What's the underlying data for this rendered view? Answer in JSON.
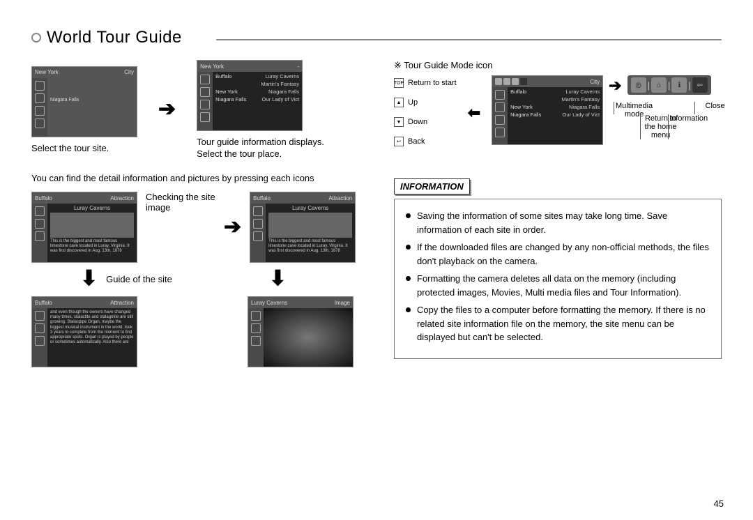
{
  "header": {
    "title": "World Tour Guide"
  },
  "left": {
    "shot1": {
      "top_left": "New York",
      "top_right": "City",
      "caption": "Select the tour site.",
      "place_label": "Niagara Falls"
    },
    "shot2": {
      "top_left": "New York",
      "top_right": "-",
      "caption1": "Tour guide information displays.",
      "caption2": "Select the tour place.",
      "list": [
        "Buffalo",
        "Luray Caverns",
        "Martin's Fantasy",
        "New York",
        "Niagara Falls",
        "Our Lady of Vict"
      ]
    },
    "para": "You can find the detail information and pictures by pressing each icons",
    "checking": "Checking the site image",
    "shot3": {
      "top_left": "Buffalo",
      "top_right": "Attraction",
      "subtitle": "Luray Caverns",
      "desc": "This is the biggest and most famous limestone cave located in Luray, Virginia. It was first discovered in Aug. 13th, 1878"
    },
    "shot4": {
      "top_left": "Buffalo",
      "top_right": "Attraction",
      "subtitle": "Luray Caverns",
      "desc": "This is the biggest and most famous limestone cave located in Luray, Virginia. It was first discovered in Aug. 13th, 1878"
    },
    "guide": "Guide of the site",
    "shot5": {
      "top_left": "Buffalo",
      "top_right": "Attraction",
      "desc": "and even though the owners have changed many times, stalactite and stalagmite are still growing. Stalacpipe Organ, maybe the biggest musical instrument in the world, took 3 years to complete from the moment to find appropriate spots. Organ is played by people or sometimes automatically. Also there are"
    },
    "shot6": {
      "top_left": "Luray Caverns",
      "top_right": "Image"
    }
  },
  "right": {
    "mode_title": "※  Tour Guide Mode icon",
    "left_legend": {
      "top": "Return to start",
      "up": "Up",
      "down": "Down",
      "back": "Back"
    },
    "mode_shot": {
      "top_right": "City",
      "list_left": [
        "Buffalo",
        "New York",
        "Niagara Falls"
      ],
      "list_right": [
        "Luray Caverns",
        "Martin's Fantasy",
        "Niagara Falls",
        "Our Lady of Vict"
      ]
    },
    "top_icons": [
      "◎",
      "⌂",
      "ℹ",
      "⇦"
    ],
    "icon_labels": {
      "multimedia": "Multimedia mode",
      "home": "Return to the home menu",
      "info": "Information",
      "close": "Close"
    },
    "info_label": "INFORMATION",
    "info_items": [
      "Saving the information of some sites may take long time. Save information of each site in order.",
      "If the downloaded files are changed by any non-official methods, the files don't playback on the camera.",
      "Formatting the camera deletes all data on the memory (including protected images, Movies, Multi media files and Tour Information).",
      "Copy the files to a computer before formatting the memory. If there is no related site information file on the memory, the site menu can be displayed but can't be selected."
    ]
  },
  "page_number": "45"
}
